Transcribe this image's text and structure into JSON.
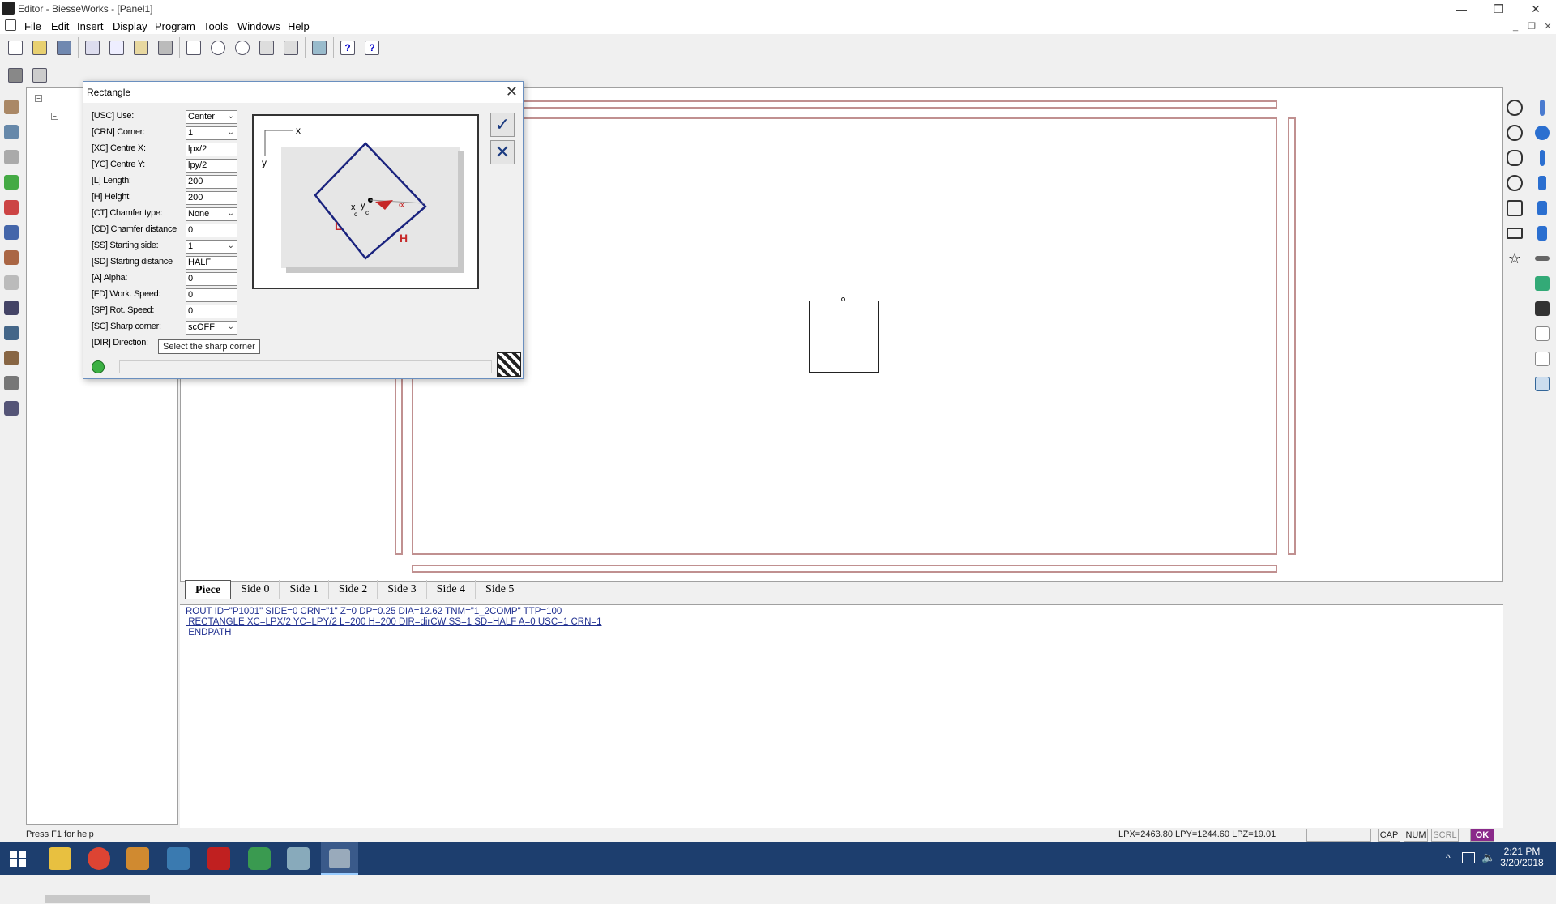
{
  "window": {
    "title": "Editor - BiesseWorks - [Panel1]"
  },
  "menu": [
    "File",
    "Edit",
    "Insert",
    "Display",
    "Program",
    "Tools",
    "Windows",
    "Help"
  ],
  "dialog": {
    "title": "Rectangle",
    "params": [
      {
        "label": "[USC] Use:",
        "value": "Center",
        "type": "select"
      },
      {
        "label": "[CRN] Corner:",
        "value": "1",
        "type": "select"
      },
      {
        "label": "[XC] Centre X:",
        "value": "lpx/2",
        "type": "input"
      },
      {
        "label": "[YC] Centre Y:",
        "value": "lpy/2",
        "type": "input"
      },
      {
        "label": "[L] Length:",
        "value": "200",
        "type": "input"
      },
      {
        "label": "[H] Height:",
        "value": "200",
        "type": "input"
      },
      {
        "label": "[CT] Chamfer type:",
        "value": "None",
        "type": "select"
      },
      {
        "label": "[CD] Chamfer distance",
        "value": "0",
        "type": "input"
      },
      {
        "label": "[SS] Starting side:",
        "value": "1",
        "type": "select"
      },
      {
        "label": "[SD] Starting distance",
        "value": "HALF",
        "type": "input"
      },
      {
        "label": "[A] Alpha:",
        "value": "0",
        "type": "input"
      },
      {
        "label": "[FD] Work. Speed:",
        "value": "0",
        "type": "input"
      },
      {
        "label": "[SP] Rot. Speed:",
        "value": "0",
        "type": "input"
      },
      {
        "label": "[SC] Sharp corner:",
        "value": "scOFF",
        "type": "select"
      },
      {
        "label": "[DIR] Direction:",
        "value": "",
        "type": "none"
      }
    ],
    "tooltip": "Select the sharp corner",
    "preview": {
      "x_axis": "x",
      "y_axis": "y",
      "len_label": "L",
      "height_label": "H",
      "alpha_label": "∝",
      "center_x": "x",
      "center_y": "y",
      "center_sub": "c"
    }
  },
  "tabs": [
    "Piece",
    "Side 0",
    "Side 1",
    "Side 2",
    "Side 3",
    "Side 4",
    "Side 5"
  ],
  "code": {
    "line1": "ROUT ID=\"P1001\" SIDE=0 CRN=\"1\" Z=0 DP=0.25 DIA=12.62 TNM=\"1_2COMP\" TTP=100",
    "line2": " RECTANGLE XC=LPX/2 YC=LPY/2 L=200 H=200 DIR=dirCW SS=1 SD=HALF A=0 USC=1 CRN=1",
    "line3": " ENDPATH"
  },
  "status": {
    "help": "Press F1 for help",
    "coords": "LPX=2463.80  LPY=1244.60  LPZ=19.01",
    "cap": "CAP",
    "num": "NUM",
    "scrl": "SCRL",
    "ok": "OK"
  },
  "clock": {
    "time": "2:21 PM",
    "date": "3/20/2018"
  },
  "colors": {
    "accent": "#1d3e6e",
    "frame": "#c09090",
    "preview_diamond": "#1a237e",
    "preview_red": "#c62828"
  }
}
